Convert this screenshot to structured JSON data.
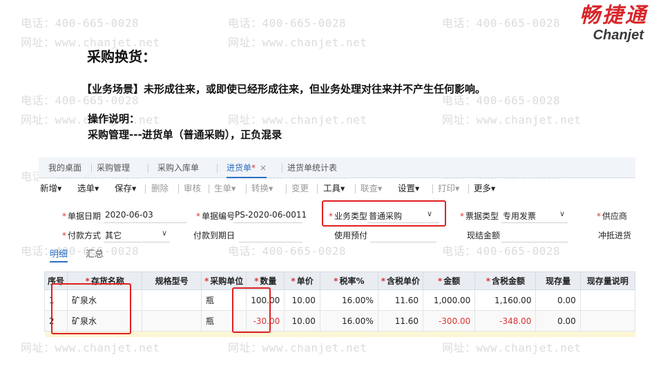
{
  "watermark": {
    "phone": "电话：400-665-0028",
    "site": "网址：www.chanjet.net"
  },
  "logo": {
    "cn": "畅捷通",
    "en": "Chanjet"
  },
  "slide": {
    "title": "采购换货：",
    "scene": "【业务场景】未形成往来，或即使已经形成往来，但业务处理对往来并不产生任何影响。",
    "op_label": "操作说明：",
    "op_path": "采购管理---进货单（普通采购），正负混录"
  },
  "tabs": [
    {
      "label": "我的桌面",
      "active": false
    },
    {
      "label": "采购管理",
      "active": false
    },
    {
      "label": "采购入库单",
      "active": false
    },
    {
      "label": "进货单",
      "active": true,
      "close": "×"
    },
    {
      "label": "进货单统计表",
      "active": false
    }
  ],
  "toolbar": [
    {
      "label": "新增",
      "enabled": true
    },
    {
      "label": "选单",
      "enabled": true
    },
    {
      "label": "保存",
      "enabled": true
    },
    {
      "label": "删除",
      "enabled": false
    },
    {
      "label": "审核",
      "enabled": false
    },
    {
      "label": "生单",
      "enabled": false
    },
    {
      "label": "转换",
      "enabled": false
    },
    {
      "label": "变更",
      "enabled": false
    },
    {
      "label": "工具",
      "enabled": true
    },
    {
      "label": "联查",
      "enabled": false
    },
    {
      "label": "设置",
      "enabled": true
    },
    {
      "label": "打印",
      "enabled": false
    },
    {
      "label": "更多",
      "enabled": true
    }
  ],
  "toolbar_dropdown_glyph": "▾",
  "form": {
    "date_label": "单据日期",
    "date_value": "2020-06-03",
    "code_label": "单据编号",
    "code_value": "PS-2020-06-0011",
    "biz_label": "业务类型",
    "biz_value": "普通采购",
    "invoice_label": "票据类型",
    "invoice_value": "专用发票",
    "supplier_label": "供应商",
    "pay_label": "付款方式",
    "pay_value": "其它",
    "due_label": "付款到期日",
    "prepay_label": "使用预付",
    "cash_label": "现结金额",
    "offset_label": "冲抵进货"
  },
  "subtabs": [
    {
      "label": "明细",
      "active": true
    },
    {
      "label": "汇总",
      "active": false
    }
  ],
  "table": {
    "columns": [
      {
        "label": "序号",
        "req": false
      },
      {
        "label": "存货名称",
        "req": true
      },
      {
        "label": "规格型号",
        "req": false
      },
      {
        "label": "采购单位",
        "req": true
      },
      {
        "label": "数量",
        "req": true
      },
      {
        "label": "单价",
        "req": true
      },
      {
        "label": "税率%",
        "req": true
      },
      {
        "label": "含税单价",
        "req": true
      },
      {
        "label": "金额",
        "req": true
      },
      {
        "label": "含税金额",
        "req": true
      },
      {
        "label": "现存量",
        "req": false
      },
      {
        "label": "现存量说明",
        "req": false
      }
    ],
    "rows": [
      {
        "no": "1",
        "name": "矿泉水",
        "spec": "",
        "unit": "瓶",
        "qty": "100.00",
        "price": "10.00",
        "tax": "16.00%",
        "taxprice": "11.60",
        "amount": "1,000.00",
        "taxamount": "1,160.00",
        "stock": "0.00",
        "stocknote": "",
        "negative": false
      },
      {
        "no": "2",
        "name": "矿泉水",
        "spec": "",
        "unit": "瓶",
        "qty": "-30.00",
        "price": "10.00",
        "tax": "16.00%",
        "taxprice": "11.60",
        "amount": "-300.00",
        "taxamount": "-348.00",
        "stock": "0.00",
        "stocknote": "",
        "negative": true
      }
    ]
  },
  "colors": {
    "accent": "#2b6fc2",
    "highlight": "#e02020",
    "brand": "#d8262a",
    "negative": "#d33333"
  }
}
